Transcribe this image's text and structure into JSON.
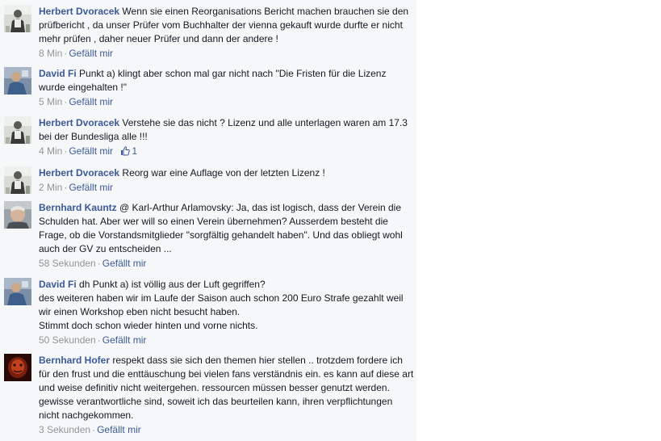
{
  "comments": [
    {
      "author": "Herbert Dvoracek",
      "text": "Wenn sie einen Reorganisations Bericht machen brauchen sie den prüfbericht , da unser Prüfer vom Buchhalter der vienna gekauft wurde durfte er nicht mehr prüfen , daher neuer Prüfer und dann der andere !",
      "time": "8 Min",
      "like_label": "Gefällt mir",
      "avatar_icon": "profile-photo-man-light"
    },
    {
      "author": "David Fi",
      "text": "Punkt a) klingt aber schon mal gar nicht nach \"Die Fristen für die Lizenz wurde eingehalten !\"",
      "time": "5 Min",
      "like_label": "Gefällt mir",
      "avatar_icon": "profile-photo-man-blue"
    },
    {
      "author": "Herbert Dvoracek",
      "text": "Verstehe sie das nicht ? Lizenz und alle unterlagen waren am 17.3 bei der Bundesliga alle !!!",
      "time": "4 Min",
      "like_label": "Gefällt mir",
      "like_count": "1",
      "avatar_icon": "profile-photo-man-light"
    },
    {
      "author": "Herbert Dvoracek",
      "text": "Reorg war eine Auflage von der letzten Lizenz !",
      "time": "2 Min",
      "like_label": "Gefällt mir",
      "avatar_icon": "profile-photo-man-light"
    },
    {
      "author": "Bernhard Kauntz",
      "text": "@ Karl-Arthur Arlamovsky: Ja, das ist logisch, dass der Verein die Schulden hat. Aber wer will so einen Verein übernehmen? Ausserdem besteht die Frage, ob die Vorstandsmitglieder \"sorgfältig gehandelt haben\". Und das obliegt wohl auch der GV zu entscheiden ...",
      "time": "58 Sekunden",
      "like_label": "Gefällt mir",
      "avatar_icon": "profile-photo-older-man"
    },
    {
      "author": "David Fi",
      "text": "dh Punkt a) ist völlig aus der Luft gegriffen?",
      "extra_lines": [
        "des weiteren haben wir im Laufe der Saison auch schon 200 Euro Strafe gezahlt weil wir einen Workshop eben nicht besucht haben.",
        "Stimmt doch schon wieder hinten und vorne nichts."
      ],
      "time": "50 Sekunden",
      "like_label": "Gefällt mir",
      "avatar_icon": "profile-photo-man-blue"
    },
    {
      "author": "Bernhard Hofer",
      "text": "respekt dass sie sich den themen hier stellen .. trotzdem fordere ich für den frust und die enttäuschung bei vielen fans verständnis ein. es kann auf diese art und weise definitiv nicht weitergehen. ressourcen müssen besser genutzt werden. gewisse verantwortliche sind, soweit ich das beurteilen kann, ihren verpflichtungen nicht nachgekommen.",
      "time": "3 Sekunden",
      "like_label": "Gefällt mir",
      "avatar_icon": "profile-photo-dark-red"
    }
  ],
  "meta_separator": "·",
  "colors": {
    "link": "#3b5998",
    "meta": "#90949c",
    "panel": "#f6f7f9"
  }
}
